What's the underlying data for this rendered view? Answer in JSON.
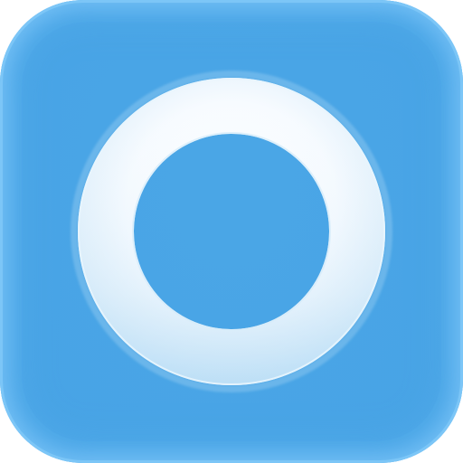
{
  "icon": {
    "name": "ring-app-icon",
    "shape": "rounded-square",
    "symbol": "circle-ring-icon",
    "colors": {
      "background": "#4aa6e6",
      "border_glow": "#7cc6f7",
      "ring_light": "#ffffff",
      "ring_shade": "#cfe8f8",
      "ring_edge": "#a9d6f5"
    }
  }
}
